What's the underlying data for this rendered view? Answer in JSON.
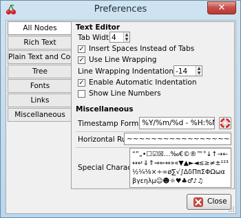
{
  "window": {
    "title": "Preferences"
  },
  "sidebar": {
    "items": [
      {
        "label": "All Nodes",
        "active": true
      },
      {
        "label": "Rich Text"
      },
      {
        "label": "Plain Text and Code"
      },
      {
        "label": "Tree"
      },
      {
        "label": "Fonts"
      },
      {
        "label": "Links"
      },
      {
        "label": "Miscellaneous"
      }
    ]
  },
  "text_editor": {
    "title": "Text Editor",
    "tab_width_label": "Tab Width",
    "tab_width_value": "4",
    "insert_spaces_label": "Insert Spaces Instead of Tabs",
    "insert_spaces_checked": true,
    "use_line_wrapping_label": "Use Line Wrapping",
    "use_line_wrapping_checked": true,
    "line_wrapping_indentation_label": "Line Wrapping Indentation",
    "line_wrapping_indentation_value": "-14",
    "auto_indent_label": "Enable Automatic Indentation",
    "auto_indent_checked": true,
    "show_line_numbers_label": "Show Line Numbers",
    "show_line_numbers_checked": false
  },
  "miscellaneous": {
    "title": "Miscellaneous",
    "timestamp_format_label": "Timestamp Format",
    "timestamp_format_value": "%Y/%m/%d - %H:%M",
    "horizontal_rule_label": "Horizontal Rule",
    "horizontal_rule_value": "~~~~~~~~~~~~~~~~~~~~~~~~~~~~~~~~~~~",
    "special_characters_label": "Special Characters",
    "special_characters_value": "“”„•☐☑☒…‰€©®™°↓↑→←↔↵⇓⇑⇒⇐⇔»«▼▲►◄≤≥≠±¹²³½¼⅛×÷∞ø∑√∫ΔδΠπΣΦΩωαβγεηλμ☺☻☼♥♣♂♪♫"
  },
  "footer": {
    "close_label": "Close"
  },
  "colors": {
    "window_frame": "#bcd6ea",
    "close_x": "#c75050",
    "reset_icon": "#d9322a"
  }
}
